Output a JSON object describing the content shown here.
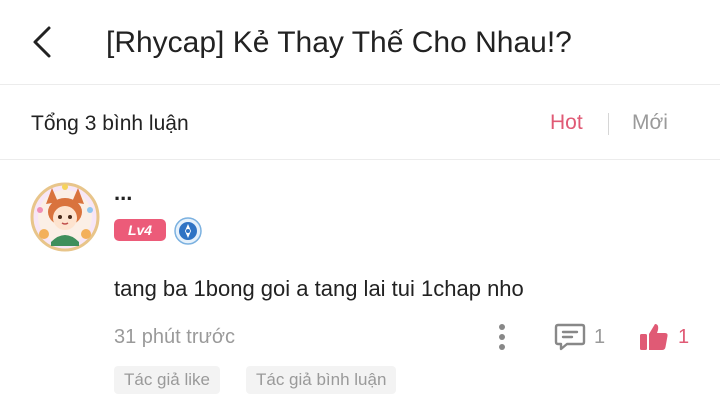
{
  "header": {
    "title": "[Rhycap] Kẻ Thay Thế Cho Nhau!?"
  },
  "summary": {
    "total_label": "Tổng 3 bình luận",
    "sort_hot": "Hot",
    "sort_new": "Mới",
    "active_color": "#e05a75"
  },
  "comment": {
    "username": "...",
    "level": "Lv4",
    "level_color": "#ec5b79",
    "text": "tang ba 1bong goi a tang lai tui 1chap nho",
    "time": "31 phút trước",
    "reply_count": "1",
    "like_count": "1",
    "tags": [
      "Tác giả like",
      "Tác giả bình luận"
    ],
    "icons": {
      "back": "chevron-left-icon",
      "more": "more-vertical-icon",
      "reply": "comment-icon",
      "like": "thumbs-up-icon",
      "role": "blue-badge-icon"
    }
  }
}
